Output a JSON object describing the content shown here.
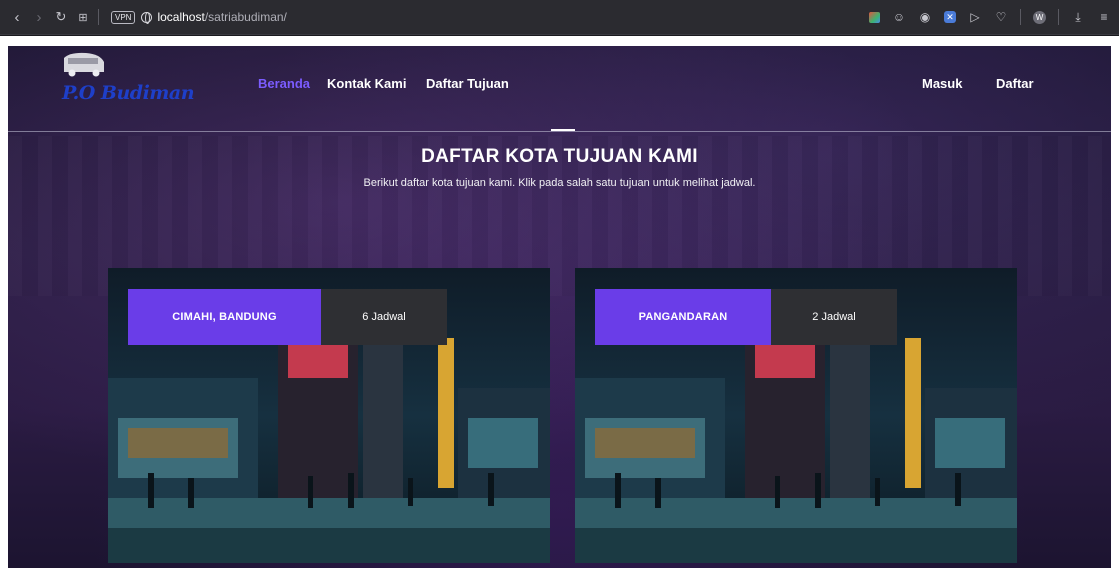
{
  "browser": {
    "url_host": "localhost",
    "url_path": "/satriabudiman/",
    "vpn_label": "VPN"
  },
  "site": {
    "logo_text": "P.O Budiman",
    "nav": [
      {
        "label": "Beranda",
        "active": true
      },
      {
        "label": "Kontak Kami",
        "active": false
      },
      {
        "label": "Daftar Tujuan",
        "active": false
      }
    ],
    "auth": [
      {
        "label": "Masuk"
      },
      {
        "label": "Daftar"
      }
    ],
    "colors": {
      "accent": "#6a3de8",
      "nav_active": "#7b5cff",
      "tag_dark": "#2e2f33"
    }
  },
  "main": {
    "title": "DAFTAR KOTA TUJUAN KAMI",
    "subtitle": "Berikut daftar kota tujuan kami. Klik pada salah satu tujuan untuk melihat jadwal.",
    "destinations": [
      {
        "name": "CIMAHI, BANDUNG",
        "schedules": "6 Jadwal"
      },
      {
        "name": "PANGANDARAN",
        "schedules": "2 Jadwal"
      }
    ]
  }
}
